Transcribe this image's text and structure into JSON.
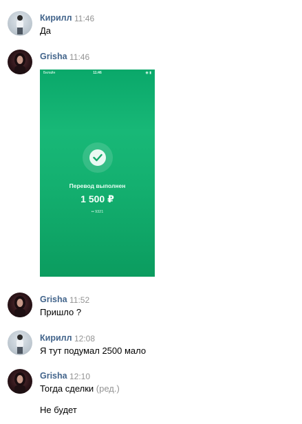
{
  "messages": [
    {
      "author": "Кирилл",
      "time": "11:46",
      "text": "Да"
    },
    {
      "author": "Grisha",
      "time": "11:46",
      "attachment": {
        "status_left": "Билайн",
        "status_time": "11:46",
        "title": "Перевод выполнен",
        "amount": "1 500 ₽",
        "card": "•• 9321"
      }
    },
    {
      "author": "Grisha",
      "time": "11:52",
      "text": "Пришло ?"
    },
    {
      "author": "Кирилл",
      "time": "12:08",
      "text": "Я тут подумал 2500 мало"
    },
    {
      "author": "Grisha",
      "time": "12:10",
      "text": "Тогда сделки",
      "edited": "(ред.)",
      "text2": "Не будет"
    }
  ],
  "colors": {
    "author": "#42648b",
    "time": "#939393",
    "screenshot_green": "#14b070"
  },
  "icons": {
    "success": "check-icon",
    "wifi": "wifi-icon"
  }
}
